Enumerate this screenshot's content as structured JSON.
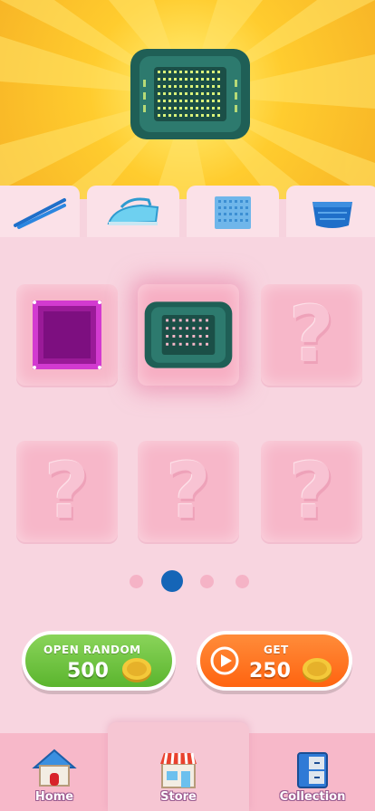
{
  "hero": {
    "icon": "green-basket-icon"
  },
  "strip": {
    "items": [
      {
        "icon": "tweezers-icon"
      },
      {
        "icon": "iron-icon"
      },
      {
        "icon": "grid-mat-icon"
      },
      {
        "icon": "blue-basket-icon"
      }
    ]
  },
  "grid": {
    "slots": [
      {
        "state": "unlocked",
        "icon": "purple-box-icon"
      },
      {
        "state": "selected",
        "icon": "green-basket-icon"
      },
      {
        "state": "locked",
        "mark": "?"
      },
      {
        "state": "locked",
        "mark": "?"
      },
      {
        "state": "locked",
        "mark": "?"
      },
      {
        "state": "locked",
        "mark": "?"
      }
    ]
  },
  "pagination": {
    "current": 2,
    "total": 4
  },
  "actions": {
    "open_random": {
      "label": "OPEN RANDOM",
      "price": "500",
      "icon": "coin-icon"
    },
    "get": {
      "label": "GET",
      "amount": "250",
      "icon": "coin-icon",
      "play_icon": "play-icon"
    }
  },
  "nav": {
    "tabs": [
      {
        "label": "Home",
        "icon": "house-icon"
      },
      {
        "label": "Store",
        "icon": "shop-icon",
        "active": true
      },
      {
        "label": "Collection",
        "icon": "cabinet-icon"
      }
    ]
  },
  "colors": {
    "accent_blue": "#1565b7",
    "green_button": "#5bb52e",
    "orange_button": "#ff6410",
    "panel_pink": "#f8d5e0"
  }
}
